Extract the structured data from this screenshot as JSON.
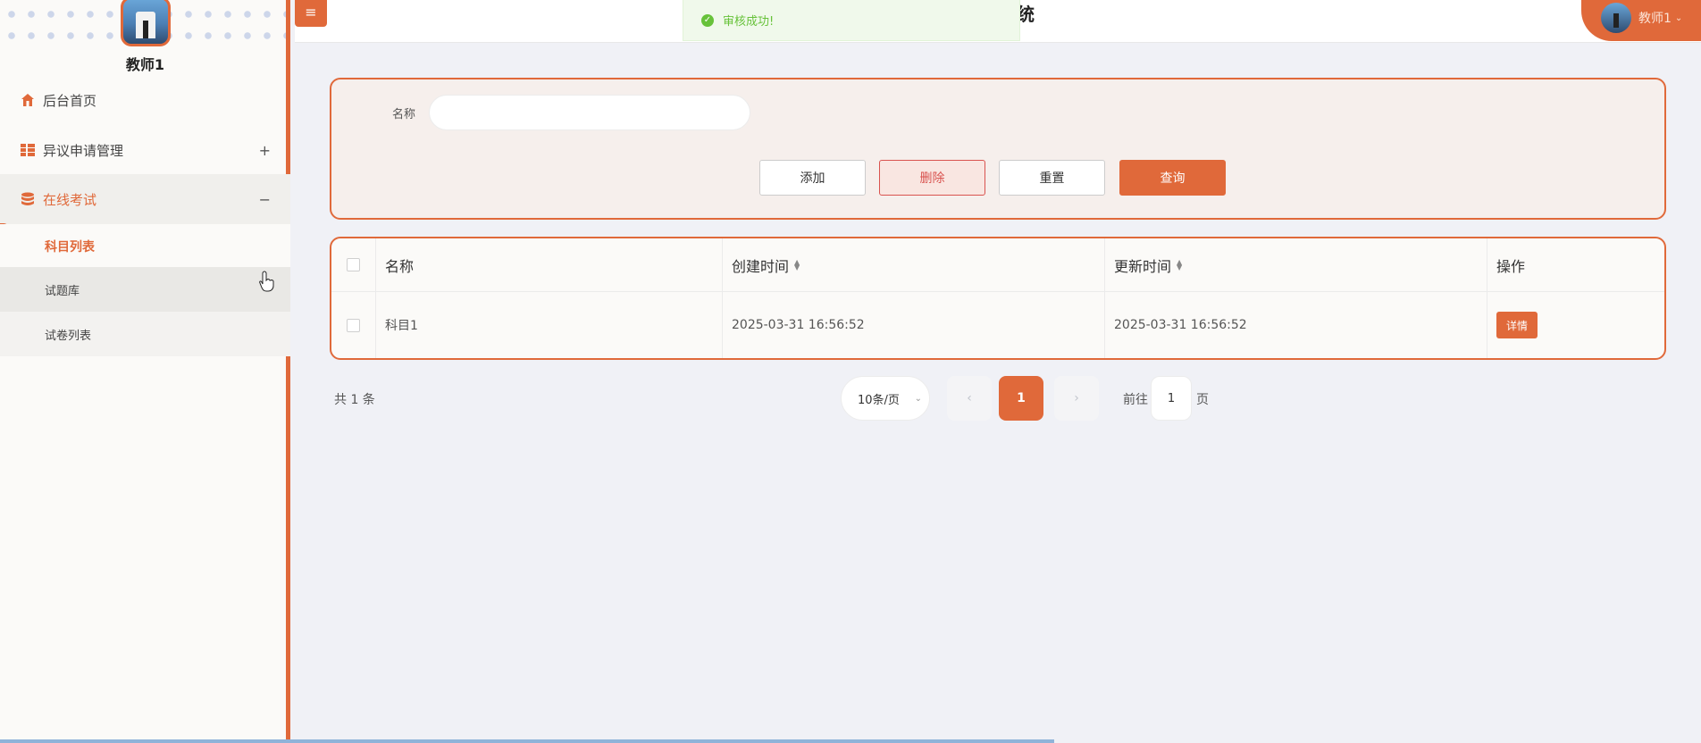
{
  "sidebar": {
    "username": "教师1",
    "menu": [
      {
        "label": "后台首页",
        "icon": "home-icon",
        "toggle": ""
      },
      {
        "label": "异议申请管理",
        "icon": "grid-icon",
        "toggle": "+"
      },
      {
        "label": "在线考试",
        "icon": "database-icon",
        "toggle": "−"
      }
    ],
    "submenu": [
      {
        "label": "科目列表",
        "active": true
      },
      {
        "label": "试题库",
        "active": false
      },
      {
        "label": "试卷列表",
        "active": false
      }
    ]
  },
  "header": {
    "menu_icon": "≡",
    "title_fragment": "统",
    "user_label": "教师1"
  },
  "toast": {
    "message": "审核成功!",
    "icon": "check-circle-icon",
    "color": "#67c23a"
  },
  "search": {
    "label": "名称",
    "value": "",
    "placeholder": "",
    "buttons": {
      "add": "添加",
      "delete": "删除",
      "reset": "重置",
      "query": "查询"
    }
  },
  "table": {
    "columns": [
      "名称",
      "创建时间",
      "更新时间",
      "操作"
    ],
    "rows": [
      {
        "name": "科目1",
        "created": "2025-03-31 16:56:52",
        "updated": "2025-03-31 16:56:52",
        "action": "详情"
      }
    ]
  },
  "pagination": {
    "total_text": "共 1 条",
    "page_size": "10条/页",
    "current_page": "1",
    "goto_prefix": "前往",
    "goto_value": "1",
    "goto_suffix": "页"
  },
  "colors": {
    "accent": "#e0693a",
    "danger": "#d9534f",
    "success": "#67c23a"
  }
}
